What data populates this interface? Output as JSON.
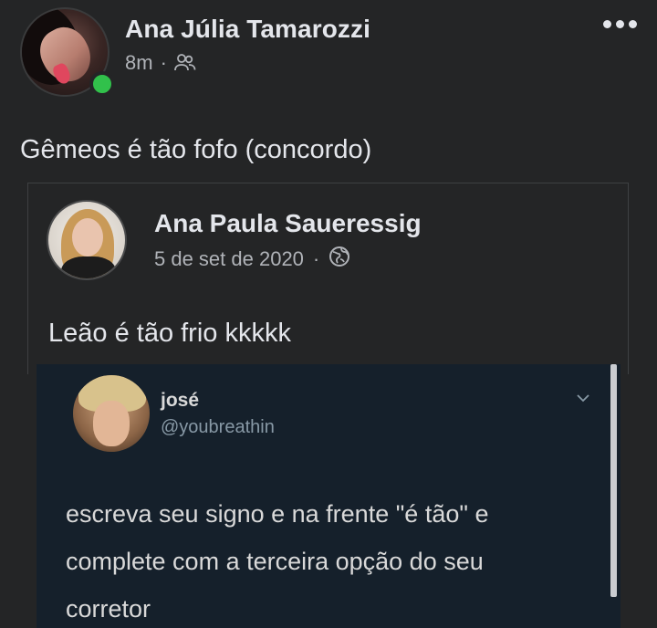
{
  "post": {
    "author": "Ana Júlia Tamarozzi",
    "time": "8m",
    "separator": "·",
    "audience_icon": "friends-icon",
    "more_icon": "more-horizontal-icon",
    "text": "Gêmeos é tão fofo  (concordo)"
  },
  "shared_post": {
    "author": "Ana Paula Saueressig",
    "date": "5 de set de 2020",
    "separator": "·",
    "audience_icon": "globe-icon",
    "text": "Leão é tão frio kkkkk"
  },
  "tweet": {
    "name": "josé",
    "handle": "@youbreathin",
    "menu_icon": "chevron-down-icon",
    "text_lines": [
      "escreva seu signo e na frente \"é tão\" e",
      "complete com a terceira opção do seu",
      "corretor"
    ],
    "background": "#15202b"
  },
  "colors": {
    "background": "#242526",
    "online": "#31c14b",
    "text_primary": "#e4e6eb",
    "text_secondary": "#b0b3b8"
  }
}
